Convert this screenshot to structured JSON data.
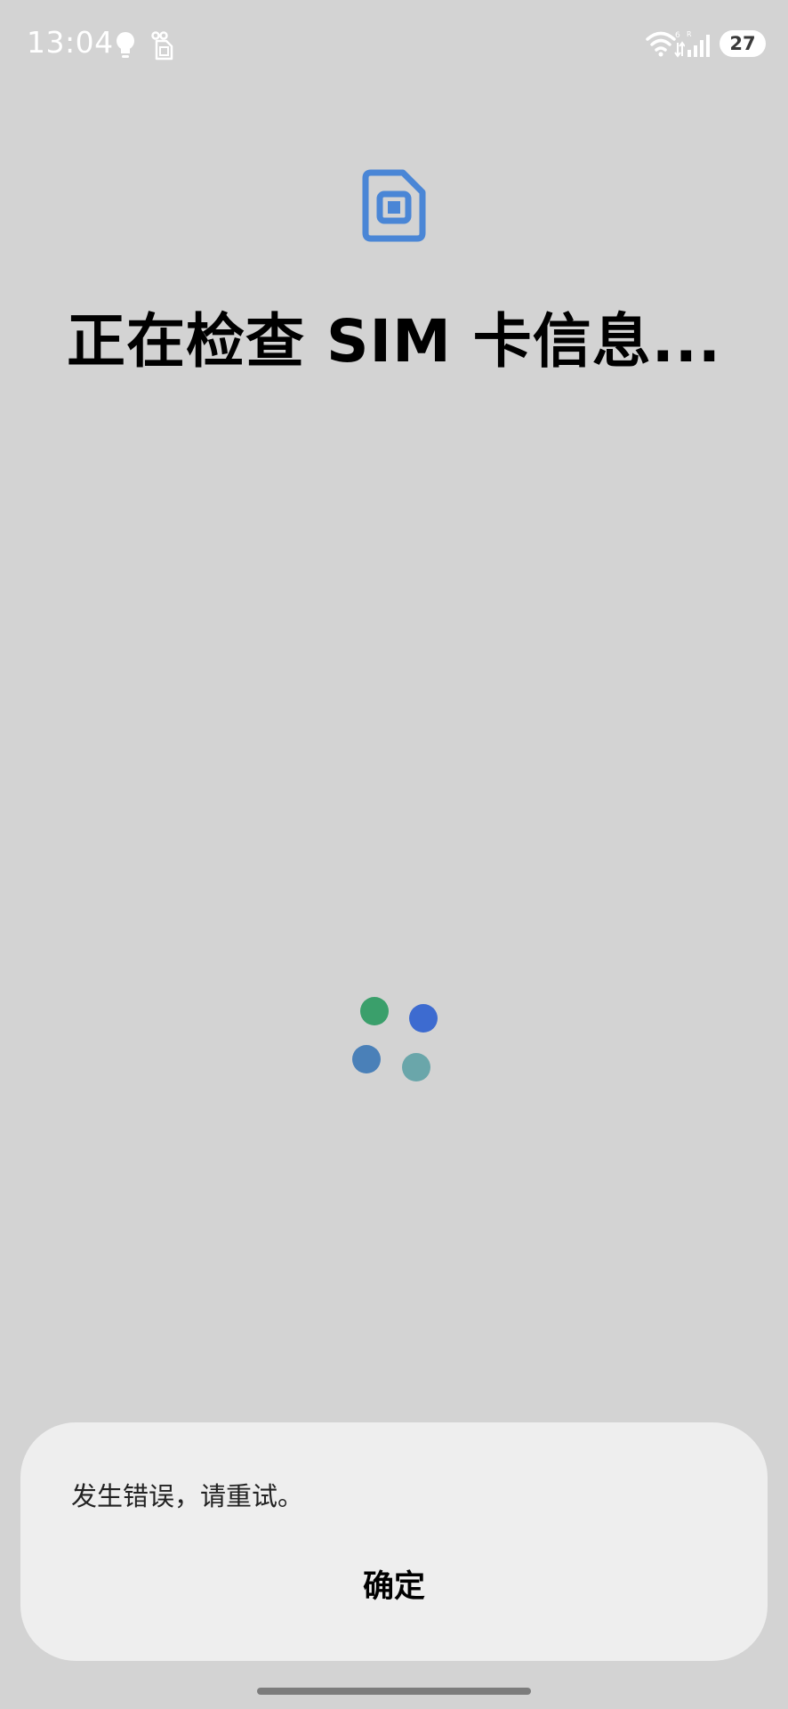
{
  "status_bar": {
    "time": "13:04",
    "battery": "27",
    "icons": [
      "bulb-icon",
      "sim-card-icon",
      "wifi-icon",
      "cell-signal-icon"
    ]
  },
  "main": {
    "icon": "sim-card-icon",
    "title": "正在检查 SIM 卡信息...",
    "loader_colors": [
      "#3a9f6b",
      "#3d6bd0",
      "#4a80b8",
      "#6aa6aa"
    ]
  },
  "dialog": {
    "message": "发生错误，请重试。",
    "confirm_label": "确定"
  },
  "colors": {
    "background": "#d3d3d3",
    "accent": "#4a86d6",
    "dialog_bg": "#eeeeee"
  }
}
